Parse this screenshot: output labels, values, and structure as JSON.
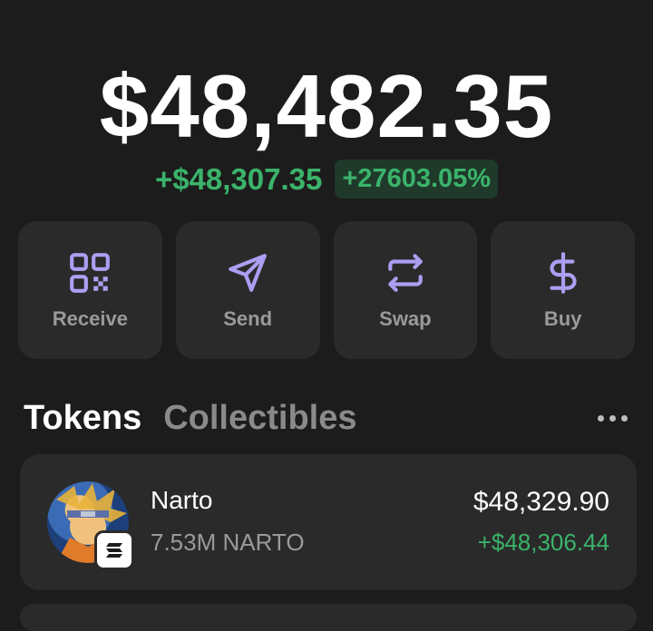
{
  "balance": {
    "total": "$48,482.35",
    "change_amount": "+$48,307.35",
    "change_percent": "+27603.05%"
  },
  "actions": [
    {
      "label": "Receive",
      "icon": "qr-code-icon"
    },
    {
      "label": "Send",
      "icon": "send-icon"
    },
    {
      "label": "Swap",
      "icon": "swap-icon"
    },
    {
      "label": "Buy",
      "icon": "dollar-icon"
    }
  ],
  "tabs": {
    "tokens": "Tokens",
    "collectibles": "Collectibles"
  },
  "tokens": [
    {
      "name": "Narto",
      "amount": "7.53M NARTO",
      "value": "$48,329.90",
      "change": "+$48,306.44"
    }
  ],
  "colors": {
    "background": "#1c1c1c",
    "card": "#2a2a2a",
    "accent": "#ab9ff2",
    "positive": "#3bb36b"
  }
}
